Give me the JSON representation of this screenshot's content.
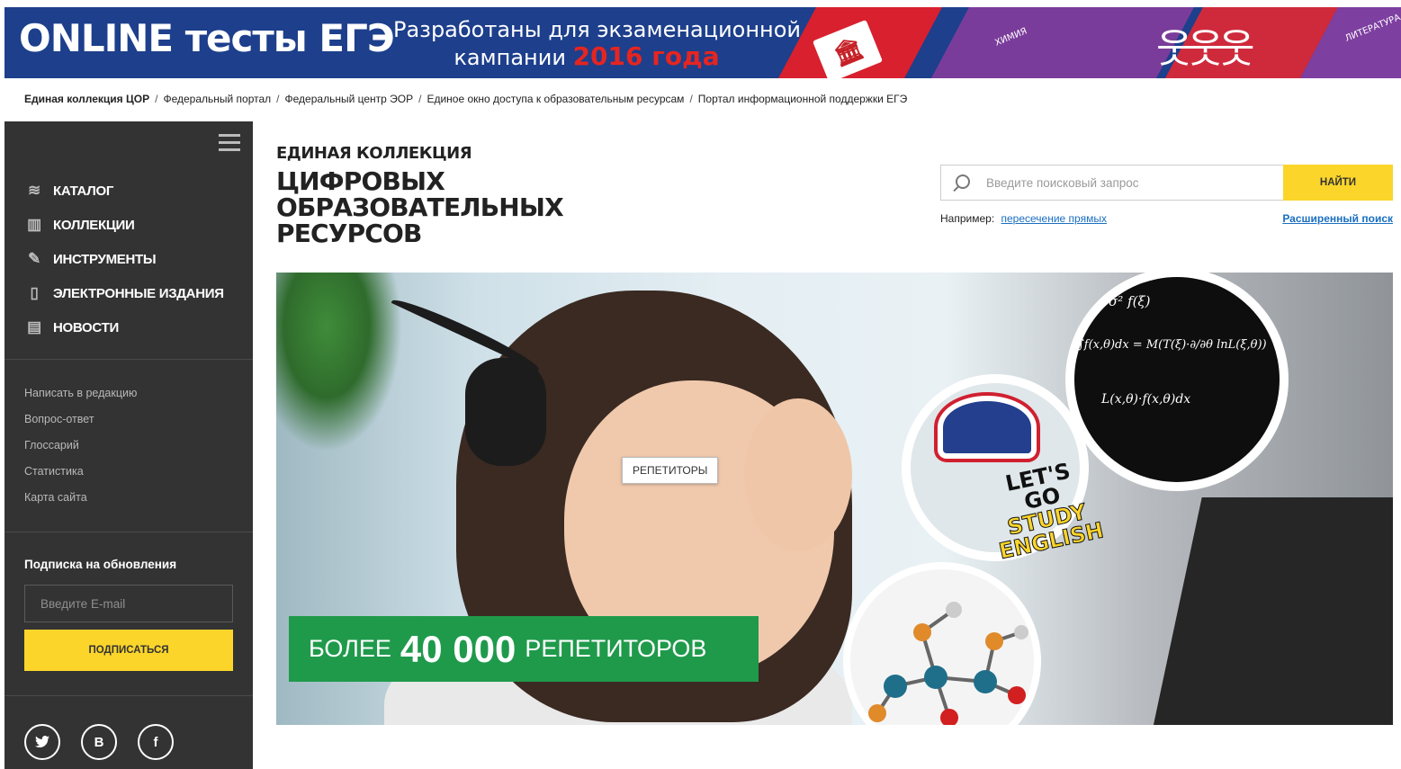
{
  "banner": {
    "title": "ONLINE тесты ЕГЭ",
    "tagline_line1": "Разработаны для экзаменационной",
    "tagline_line2_prefix": "кампании",
    "tagline_year": "2016 года",
    "subject_1": "ХИМИЯ",
    "subject_2": "ЛИТЕРАТУРА"
  },
  "breadcrumb": {
    "items": [
      "Единая коллекция ЦОР",
      "Федеральный портал",
      "Федеральный центр ЭОР",
      "Единое окно доступа к образовательным ресурсам",
      "Портал информационной поддержки ЕГЭ"
    ],
    "separator": "/"
  },
  "sidebar": {
    "nav": [
      {
        "label": "КАТАЛОГ",
        "icon": "layers-icon"
      },
      {
        "label": "КОЛЛЕКЦИИ",
        "icon": "books-icon"
      },
      {
        "label": "ИНСТРУМЕНТЫ",
        "icon": "pencil-icon"
      },
      {
        "label": "ЭЛЕКТРОННЫЕ ИЗДАНИЯ",
        "icon": "tablet-icon"
      },
      {
        "label": "НОВОСТИ",
        "icon": "news-icon"
      }
    ],
    "links": [
      "Написать в редакцию",
      "Вопрос-ответ",
      "Глоссарий",
      "Статистика",
      "Карта сайта"
    ],
    "subscribe": {
      "title": "Подписка на обновления",
      "email_placeholder": "Введите E-mail",
      "button_label": "ПОДПИСАТЬСЯ"
    },
    "social": [
      {
        "label": "",
        "icon": "twitter-icon",
        "glyph": "🐦"
      },
      {
        "label": "В",
        "icon": "vk-icon"
      },
      {
        "label": "f",
        "icon": "facebook-icon"
      }
    ]
  },
  "header": {
    "title_small": "ЕДИНАЯ КОЛЛЕКЦИЯ",
    "title_line1": "ЦИФРОВЫХ",
    "title_line2": "ОБРАЗОВАТЕЛЬНЫХ",
    "title_line3": "РЕСУРСОВ"
  },
  "search": {
    "placeholder": "Введите поисковый запрос",
    "button_label": "НАЙТИ",
    "example_label": "Например:",
    "example_link": "пересечение прямых",
    "advanced_link": "Расширенный поиск"
  },
  "hero": {
    "tooltip": "РЕПЕТИТОРЫ",
    "promo_prefix": "БОЛЕЕ",
    "promo_number": "40 000",
    "promo_suffix": "РЕПЕТИТОРОВ",
    "english_line1": "LET'S",
    "english_line2": "GO",
    "english_line3": "STUDY",
    "english_line4": "ENGLISH",
    "formula_1": "∫f(x,θ)dx = M(T(ξ)·∂/∂θ lnL(ξ,θ))",
    "formula_2": "L(x,θ)·f(x,θ)dx",
    "formula_3": "σ²   f(ξ)"
  },
  "colors": {
    "banner_bg": "#1d3f8c",
    "sidebar_bg": "#333333",
    "accent_yellow": "#fbd52a",
    "promo_green": "#1f9a4b",
    "link_blue": "#1a6fc0",
    "year_red": "#e52521"
  }
}
